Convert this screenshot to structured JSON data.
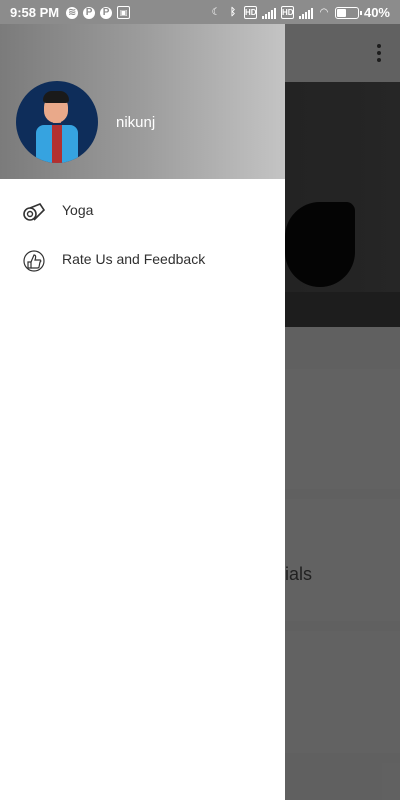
{
  "status_bar": {
    "time": "9:58 PM",
    "battery_percent": "40%",
    "left_icons": [
      "spotify-icon",
      "p-icon",
      "p-icon",
      "notification-icon"
    ],
    "right_icons": [
      "moon-icon",
      "bluetooth-icon",
      "volte-icon",
      "signal-icon",
      "volte-icon",
      "signal-icon",
      "wifi-icon",
      "battery-icon"
    ]
  },
  "drawer": {
    "user_name": "nikunj",
    "items": [
      {
        "label": "Yoga",
        "icon": "yoga-mat-icon"
      },
      {
        "label": "Rate Us and Feedback",
        "icon": "thumbs-up-icon"
      }
    ]
  },
  "background": {
    "card_text": "ntials",
    "menu_icon": "more-vert-icon"
  }
}
